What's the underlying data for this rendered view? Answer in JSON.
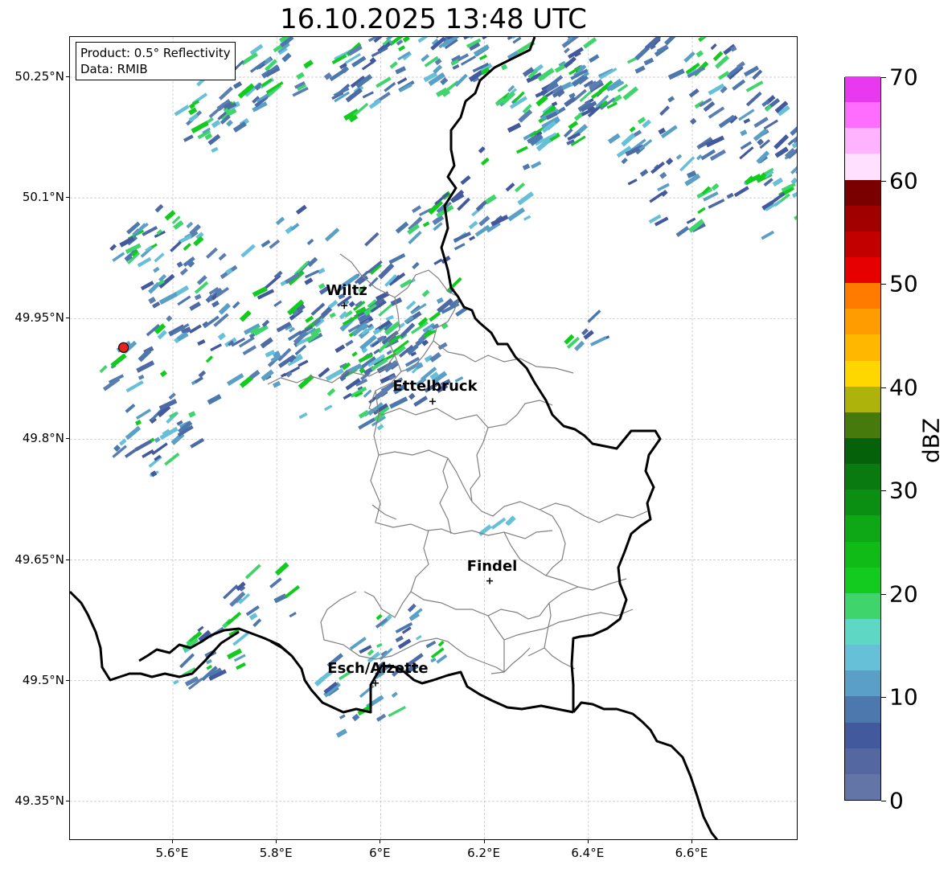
{
  "title": "16.10.2025 13:48 UTC",
  "infobox": {
    "product": "Product: 0.5° Reflectivity",
    "data": "Data: RMIB"
  },
  "lat_ticks": [
    {
      "value": 50.25,
      "label": "50.25°N"
    },
    {
      "value": 50.1,
      "label": "50.1°N"
    },
    {
      "value": 49.95,
      "label": "49.95°N"
    },
    {
      "value": 49.8,
      "label": "49.8°N"
    },
    {
      "value": 49.65,
      "label": "49.65°N"
    },
    {
      "value": 49.5,
      "label": "49.5°N"
    },
    {
      "value": 49.35,
      "label": "49.35°N"
    }
  ],
  "lon_ticks": [
    {
      "value": 5.6,
      "label": "5.6°E"
    },
    {
      "value": 5.8,
      "label": "5.8°E"
    },
    {
      "value": 6.0,
      "label": "6°E"
    },
    {
      "value": 6.2,
      "label": "6.2°E"
    },
    {
      "value": 6.4,
      "label": "6.4°E"
    },
    {
      "value": 6.6,
      "label": "6.6°E"
    }
  ],
  "cities": [
    {
      "name": "Wiltz",
      "lon": 5.93,
      "lat": 49.966
    },
    {
      "name": "Ettelbruck",
      "lon": 6.1,
      "lat": 49.847
    },
    {
      "name": "Findel",
      "lon": 6.21,
      "lat": 49.624
    },
    {
      "name": "Esch/Alzette",
      "lon": 5.99,
      "lat": 49.497
    }
  ],
  "radar_site": {
    "lon": 5.505,
    "lat": 49.914,
    "color": "#e8221e"
  },
  "colorbar": {
    "label": "dBZ",
    "min": 0,
    "max": 70,
    "step": 2.5,
    "ticks": [
      "0",
      "10",
      "20",
      "30",
      "40",
      "50",
      "60",
      "70"
    ],
    "colors": [
      "#6375a6",
      "#54689f",
      "#43599d",
      "#4d78ad",
      "#5aa0c6",
      "#66c0d8",
      "#5ed8c4",
      "#3fd46c",
      "#12cb1e",
      "#10bb18",
      "#0ea715",
      "#0b8f12",
      "#097a0f",
      "#06620a",
      "#467a0c",
      "#adb30a",
      "#ffd700",
      "#ffb700",
      "#ff9c00",
      "#ff7b00",
      "#e60000",
      "#c20000",
      "#a00000",
      "#7a0000",
      "#ffe1ff",
      "#ffb3ff",
      "#ff6dff",
      "#e939f0"
    ]
  },
  "colors": {
    "border": "#000000",
    "canton": "#808080",
    "grid": "#bfbfbf"
  }
}
